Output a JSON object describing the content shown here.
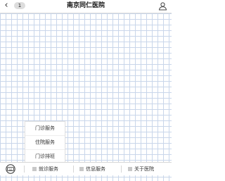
{
  "header": {
    "back_icon": "chevron-left-icon",
    "badge_count": "1",
    "title": "南京同仁医院",
    "user_icon": "person-icon"
  },
  "popup": {
    "items": [
      {
        "label": "门诊服务"
      },
      {
        "label": "住院服务"
      },
      {
        "label": "门诊排班"
      }
    ]
  },
  "menu_bar": {
    "keyboard_icon": "keyboard-icon",
    "items": [
      {
        "label": "就诊服务"
      },
      {
        "label": "信息服务"
      },
      {
        "label": "关于医院"
      }
    ]
  },
  "colors": {
    "grid_line": "#c9d6ea",
    "background": "#ffffff"
  }
}
